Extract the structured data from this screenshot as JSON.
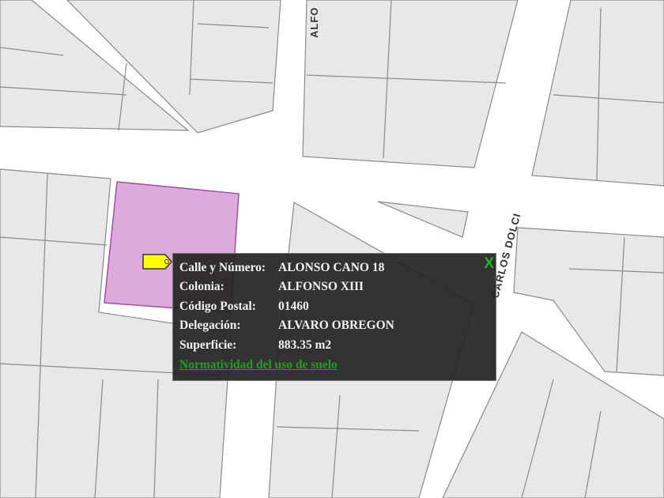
{
  "map": {
    "streets": [
      "ALFO",
      "CARLOS DOLCI"
    ],
    "parcel_color": "#dcaadc",
    "marker_color": "#ffff00"
  },
  "popup": {
    "fields": [
      {
        "label": "Calle y Número:",
        "value": "ALONSO CANO 18"
      },
      {
        "label": "Colonia:",
        "value": "ALFONSO XIII"
      },
      {
        "label": "Código Postal:",
        "value": "01460"
      },
      {
        "label": "Delegación:",
        "value": "ALVARO OBREGON"
      },
      {
        "label": "Superficie:",
        "value": "883.35 m2"
      }
    ],
    "link": "Normatividad del uso de suelo",
    "close": "X"
  }
}
